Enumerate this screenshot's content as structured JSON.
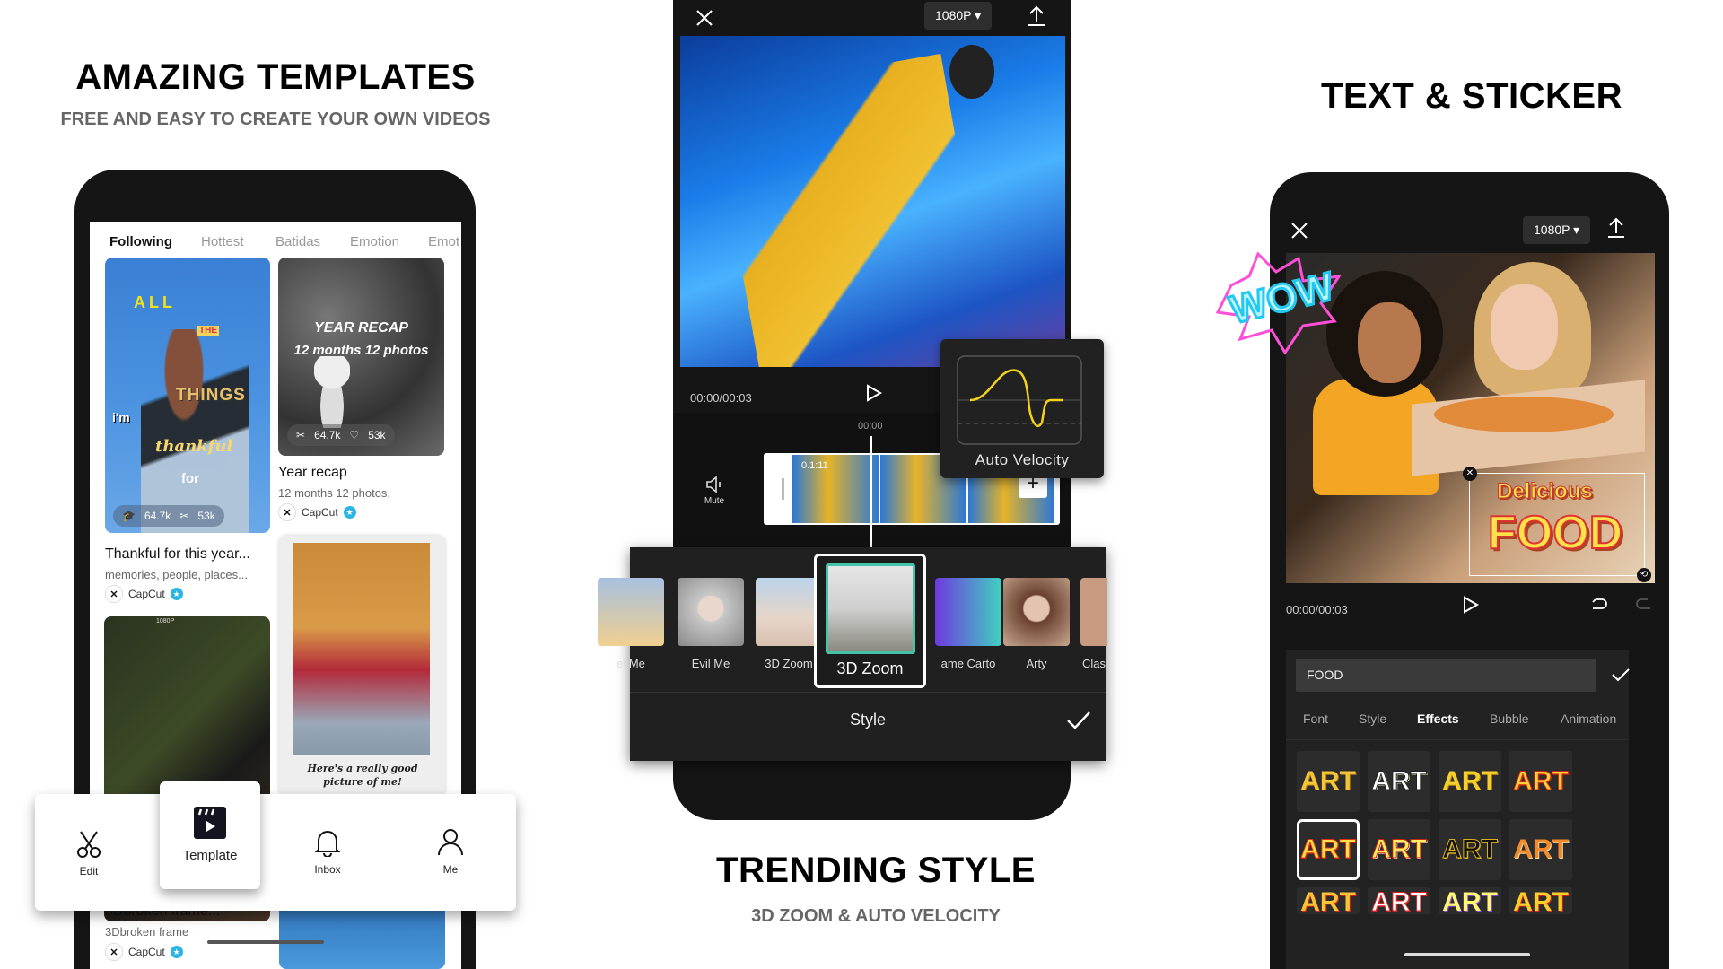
{
  "panels": {
    "left": {
      "title": "AMAZING TEMPLATES",
      "subtitle": "FREE AND EASY TO CREATE YOUR OWN VIDEOS"
    },
    "middle": {
      "title": "TRENDING STYLE",
      "subtitle": "3D ZOOM & AUTO VELOCITY"
    },
    "right": {
      "title": "TEXT & STICKER"
    }
  },
  "template_screen": {
    "tabs": [
      "Following",
      "Hottest",
      "Batidas",
      "Emotion",
      "Emot"
    ],
    "active_tab": "Following",
    "cards": [
      {
        "overlay_words": [
          "ALL",
          "THE",
          "THINGS",
          "i'm",
          "thankful",
          "for"
        ],
        "stat1": "64.7k",
        "stat2": "53k",
        "title": "Thankful for this year...",
        "subtitle": "memories, people, places...",
        "author": "CapCut"
      },
      {
        "overlay_line1": "YEAR RECAP",
        "overlay_line2": "12 months 12 photos",
        "stat1": "64.7k",
        "stat2": "53k",
        "title": "Year recap",
        "subtitle": "12 months 12 photos.",
        "author": "CapCut"
      },
      {
        "badge": "1080P"
      },
      {
        "caption": "Here's a really good picture of me!"
      },
      {
        "title": "3Dbroken frame...",
        "subtitle": "3Dbroken frame",
        "author": "CapCut"
      }
    ],
    "nav": {
      "edit": "Edit",
      "template": "Template",
      "inbox": "Inbox",
      "me": "Me",
      "active": "Template"
    }
  },
  "style_screen": {
    "resolution": "1080P",
    "time": "00:00/00:03",
    "ruler_time": "00:00",
    "clip_label": "0.1:11",
    "mute_label": "Mute",
    "velocity_label": "Auto Velocity",
    "styles": [
      "el Me",
      "Evil Me",
      "3D Zoom",
      "3D Zoom",
      "ame Carto",
      "Arty",
      "Clas"
    ],
    "selected_style": "3D Zoom",
    "panel_title": "Style"
  },
  "text_screen": {
    "resolution": "1080P",
    "time": "00:00/00:03",
    "stickers": {
      "wow": "WOW",
      "line1": "Delicious",
      "line2": "FOOD"
    },
    "text_value": "FOOD",
    "tabs": [
      "Font",
      "Style",
      "Effects",
      "Bubble",
      "Animation"
    ],
    "active_tab": "Effects",
    "effect_label": "ART"
  }
}
